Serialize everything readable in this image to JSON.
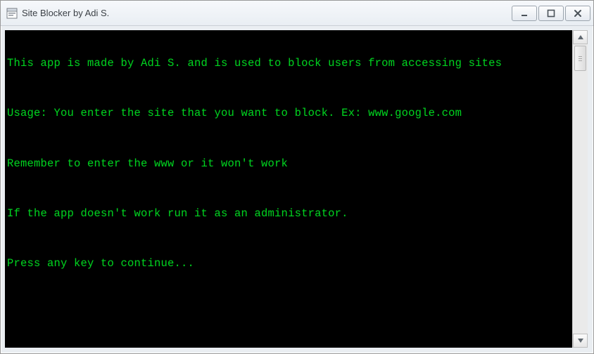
{
  "window": {
    "title": "Site Blocker by Adi S."
  },
  "console": {
    "lines": [
      "This app is made by Adi S. and is used to block users from accessing sites",
      "Usage: You enter the site that you want to block. Ex: www.google.com",
      "Remember to enter the www or it won't work",
      "If the app doesn't work run it as an administrator.",
      "Press any key to continue..."
    ]
  },
  "colors": {
    "console_bg": "#000000",
    "console_fg": "#00d020"
  }
}
